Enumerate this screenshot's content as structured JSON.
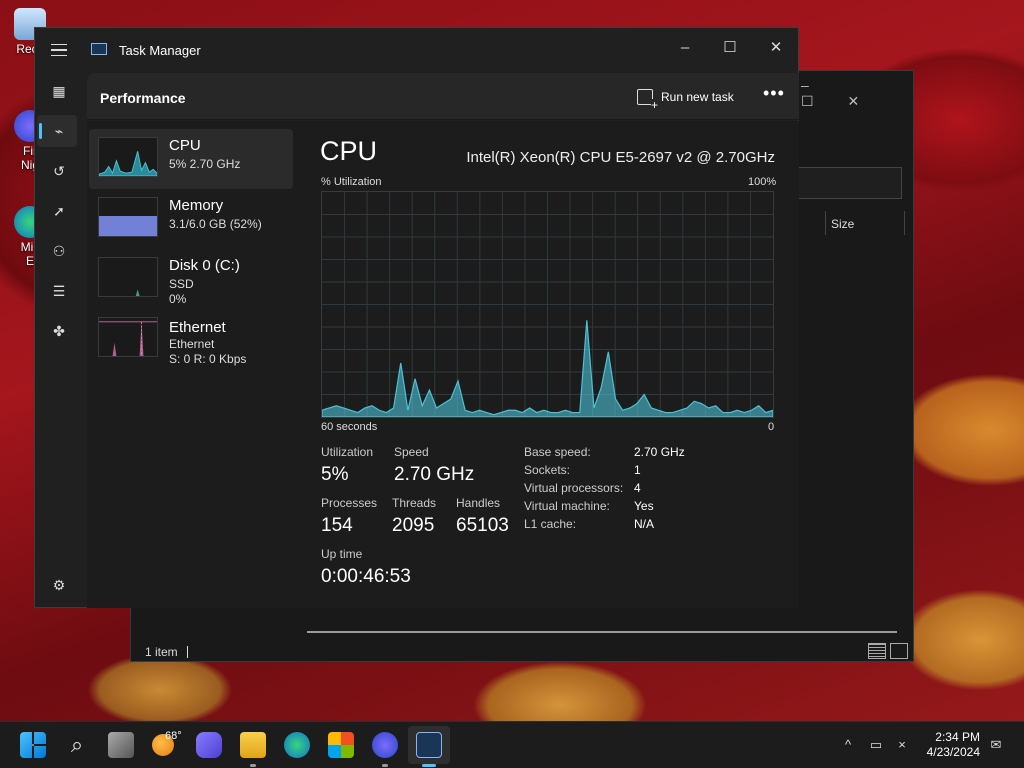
{
  "desktop": {
    "icons": [
      {
        "label": "Recy",
        "icon": "recycle-bin-icon"
      },
      {
        "label": "Fir\nNig",
        "icon": "firefox-nightly-icon"
      },
      {
        "label": "Mic\nE",
        "icon": "edge-icon"
      }
    ]
  },
  "explorer": {
    "column_size": "Size",
    "status": "1 item"
  },
  "window": {
    "title": "Task Manager",
    "minimize": "–",
    "maximize": "☐",
    "close": "✕"
  },
  "nav": {
    "items": [
      {
        "name": "processes",
        "icon": "processes-icon",
        "glyph": "▦"
      },
      {
        "name": "performance",
        "icon": "performance-icon",
        "glyph": "⌁",
        "active": true
      },
      {
        "name": "app-history",
        "icon": "history-icon",
        "glyph": "↺"
      },
      {
        "name": "startup-apps",
        "icon": "startup-icon",
        "glyph": "➚"
      },
      {
        "name": "users",
        "icon": "users-icon",
        "glyph": "⚇"
      },
      {
        "name": "details",
        "icon": "details-icon",
        "glyph": "☰"
      },
      {
        "name": "services",
        "icon": "services-icon",
        "glyph": "✤"
      }
    ],
    "settings_glyph": "⚙"
  },
  "header": {
    "title": "Performance",
    "run_new_task": "Run new task",
    "more": "•••"
  },
  "devices": [
    {
      "name": "CPU",
      "line1": "5%  2.70 GHz",
      "line2": ""
    },
    {
      "name": "Memory",
      "line1": "3.1/6.0 GB (52%)",
      "line2": ""
    },
    {
      "name": "Disk 0 (C:)",
      "line1": "SSD",
      "line2": "0%"
    },
    {
      "name": "Ethernet",
      "line1": "Ethernet",
      "line2": "S: 0  R: 0 Kbps"
    }
  ],
  "cpu": {
    "title": "CPU",
    "model": "Intel(R) Xeon(R) CPU E5-2697 v2 @ 2.70GHz",
    "y_label": "% Utilization",
    "y_max": "100%",
    "x_left": "60 seconds",
    "x_right": "0",
    "graph_color": "#4cc2d6",
    "stats": {
      "utilization_label": "Utilization",
      "utilization": "5%",
      "speed_label": "Speed",
      "speed": "2.70 GHz",
      "processes_label": "Processes",
      "processes": "154",
      "threads_label": "Threads",
      "threads": "2095",
      "handles_label": "Handles",
      "handles": "65103",
      "uptime_label": "Up time",
      "uptime": "0:00:46:53"
    },
    "info": [
      {
        "label": "Base speed:",
        "value": "2.70 GHz"
      },
      {
        "label": "Sockets:",
        "value": "1"
      },
      {
        "label": "Virtual processors:",
        "value": "4"
      },
      {
        "label": "Virtual machine:",
        "value": "Yes"
      },
      {
        "label": "L1 cache:",
        "value": "N/A"
      }
    ],
    "history_percent": [
      3,
      4,
      5,
      4,
      3,
      2,
      4,
      5,
      3,
      2,
      4,
      24,
      3,
      17,
      5,
      12,
      4,
      6,
      8,
      16,
      3,
      2,
      3,
      2,
      1,
      2,
      3,
      3,
      2,
      4,
      2,
      3,
      2,
      2,
      3,
      2,
      2,
      43,
      4,
      13,
      29,
      8,
      3,
      4,
      6,
      10,
      4,
      3,
      2,
      2,
      3,
      4,
      7,
      6,
      4,
      5,
      2,
      2,
      3,
      2,
      3,
      5,
      2,
      3
    ]
  },
  "taskbar": {
    "weather": "68°",
    "time": "2:34 PM",
    "date": "4/23/2024"
  }
}
